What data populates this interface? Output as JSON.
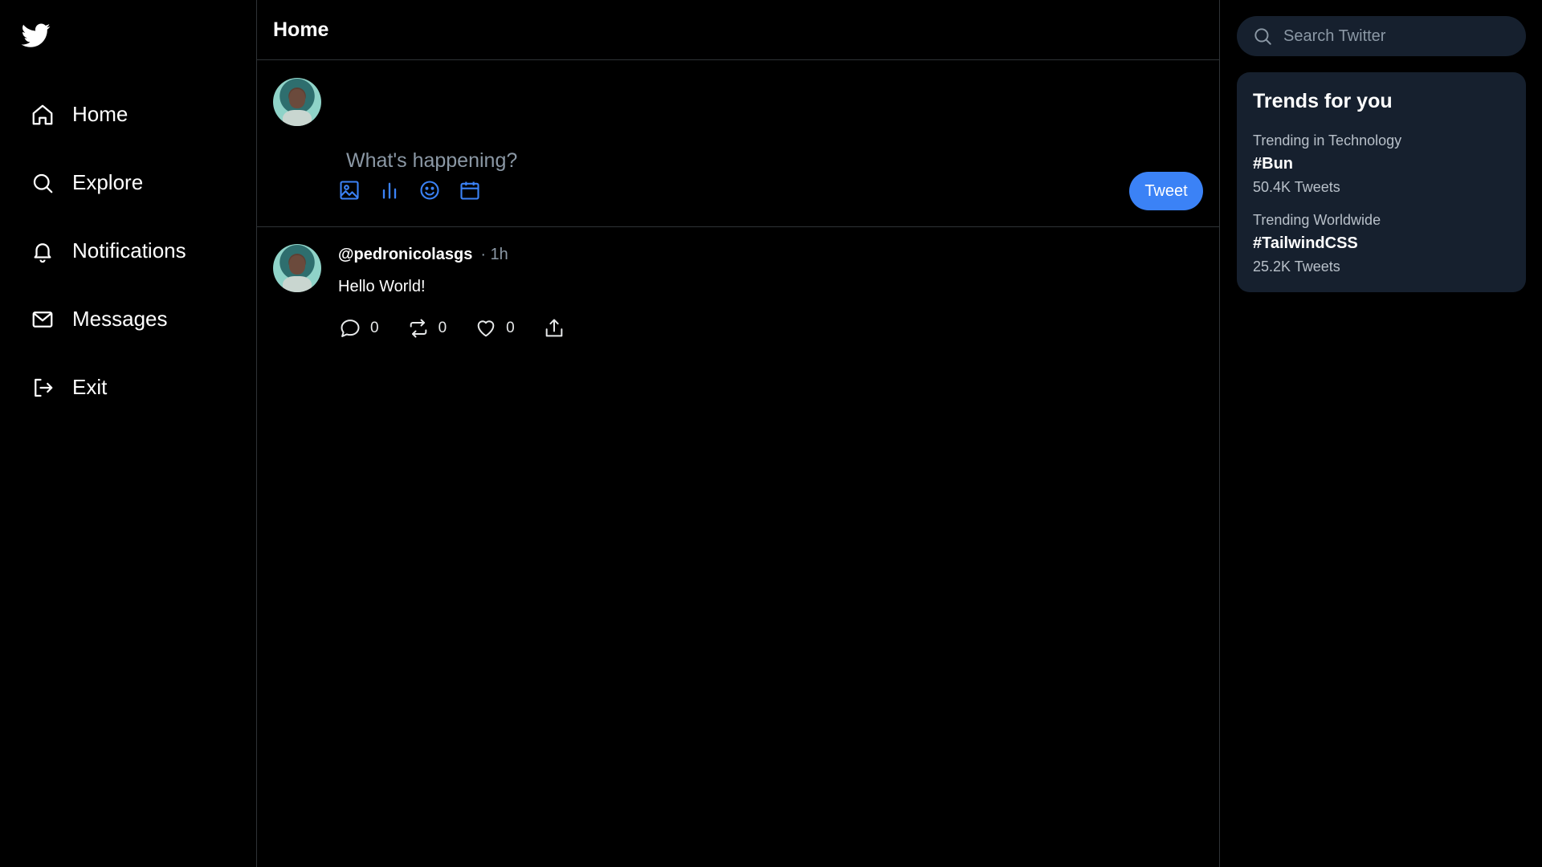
{
  "sidebar": {
    "logo": "twitter-bird-icon",
    "items": [
      {
        "label": "Home",
        "icon": "home-icon"
      },
      {
        "label": "Explore",
        "icon": "search-icon"
      },
      {
        "label": "Notifications",
        "icon": "bell-icon"
      },
      {
        "label": "Messages",
        "icon": "mail-icon"
      },
      {
        "label": "Exit",
        "icon": "logout-icon"
      }
    ]
  },
  "main": {
    "title": "Home",
    "composer": {
      "placeholder": "What's happening?",
      "tools": [
        "image-icon",
        "poll-icon",
        "emoji-icon",
        "calendar-icon"
      ],
      "tweet_button": "Tweet"
    },
    "tweets": [
      {
        "username": "@pedronicolasgs",
        "time": "· 1h",
        "text": "Hello World!",
        "replies": "0",
        "retweets": "0",
        "likes": "0"
      }
    ]
  },
  "right": {
    "search_placeholder": "Search Twitter",
    "trends_title": "Trends for you",
    "trends": [
      {
        "context": "Trending in Technology",
        "tag": "#Bun",
        "count": "50.4K Tweets"
      },
      {
        "context": "Trending Worldwide",
        "tag": "#TailwindCSS",
        "count": "25.2K Tweets"
      }
    ]
  },
  "colors": {
    "background": "#000000",
    "accent": "#3b82f6",
    "panel": "#16202e",
    "muted": "#8b98a5",
    "border": "#2f3336"
  }
}
